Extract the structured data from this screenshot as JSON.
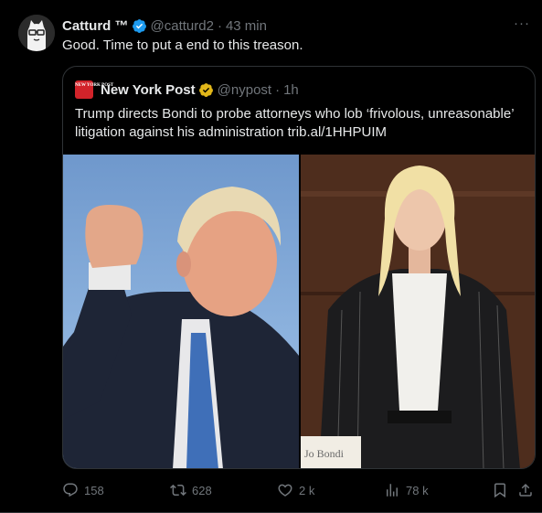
{
  "tweet": {
    "author_name": "Catturd ™",
    "author_handle": "@catturd2",
    "separator": "·",
    "time": "43 min",
    "text": "Good. Time to put a end to this treason.",
    "more_label": "···"
  },
  "quote": {
    "logo_text": "NEW YORK POST",
    "author_name": "New York Post",
    "author_handle": "@nypost",
    "separator": "·",
    "time": "1h",
    "text": "Trump directs Bondi to probe attorneys who lob ‘frivolous, unreasonable’ litigation against his administration trib.al/1HHPUIM",
    "nameplate_text": "Jo Bondi"
  },
  "actions": {
    "replies": "158",
    "reposts": "628",
    "likes": "2 k",
    "views": "78 k"
  },
  "colors": {
    "background": "#000000",
    "text": "#e7e9ea",
    "muted": "#71767b",
    "border": "#2f3336",
    "verified_blue": "#1d9bf0",
    "verified_gold": "#e2b719",
    "nypost_red": "#d2232a"
  }
}
